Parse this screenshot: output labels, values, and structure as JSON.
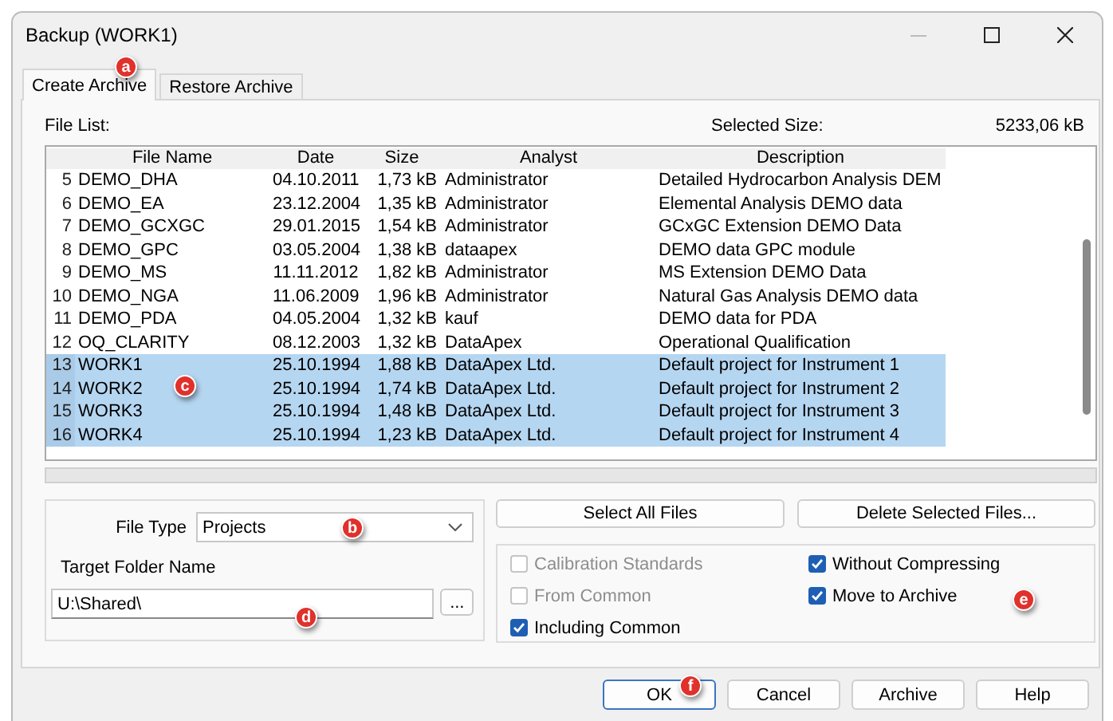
{
  "window": {
    "title": "Backup (WORK1)"
  },
  "tabs": [
    {
      "label": "Create Archive",
      "selected": true,
      "callout": "a"
    },
    {
      "label": "Restore Archive",
      "selected": false
    }
  ],
  "file_list": {
    "label": "File List:",
    "selected_size_label": "Selected Size:",
    "selected_size": "5233,06 kB"
  },
  "table": {
    "columns": [
      "File Name",
      "Date",
      "Size",
      "Analyst",
      "Description"
    ],
    "callout": "c",
    "rows": [
      {
        "number": "5",
        "cells": [
          "DEMO_DHA",
          "04.10.2011",
          "1,73 kB",
          "Administrator",
          "Detailed Hydrocarbon Analysis DEM"
        ],
        "selected": false
      },
      {
        "number": "6",
        "cells": [
          "DEMO_EA",
          "23.12.2004",
          "1,35 kB",
          "Administrator",
          "Elemental Analysis DEMO data"
        ],
        "selected": false
      },
      {
        "number": "7",
        "cells": [
          "DEMO_GCXGC",
          "29.01.2015",
          "1,54 kB",
          "Administrator",
          "GCxGC Extension DEMO Data"
        ],
        "selected": false
      },
      {
        "number": "8",
        "cells": [
          "DEMO_GPC",
          "03.05.2004",
          "1,38 kB",
          "dataapex",
          "DEMO data GPC module"
        ],
        "selected": false
      },
      {
        "number": "9",
        "cells": [
          "DEMO_MS",
          "11.11.2012",
          "1,82 kB",
          "Administrator",
          "MS Extension DEMO Data"
        ],
        "selected": false
      },
      {
        "number": "10",
        "cells": [
          "DEMO_NGA",
          "11.06.2009",
          "1,96 kB",
          "Administrator",
          "Natural Gas Analysis DEMO data"
        ],
        "selected": false
      },
      {
        "number": "11",
        "cells": [
          "DEMO_PDA",
          "04.05.2004",
          "1,32 kB",
          "kauf",
          "DEMO data for PDA"
        ],
        "selected": false
      },
      {
        "number": "12",
        "cells": [
          "OQ_CLARITY",
          "08.12.2003",
          "1,32 kB",
          "DataApex",
          "Operational Qualification"
        ],
        "selected": false
      },
      {
        "number": "13",
        "cells": [
          "WORK1",
          "25.10.1994",
          "1,88 kB",
          "DataApex Ltd.",
          "Default project for Instrument 1"
        ],
        "selected": true
      },
      {
        "number": "14",
        "cells": [
          "WORK2",
          "25.10.1994",
          "1,74 kB",
          "DataApex Ltd.",
          "Default project for Instrument 2"
        ],
        "selected": true
      },
      {
        "number": "15",
        "cells": [
          "WORK3",
          "25.10.1994",
          "1,48 kB",
          "DataApex Ltd.",
          "Default project for Instrument 3"
        ],
        "selected": true
      },
      {
        "number": "16",
        "cells": [
          "WORK4",
          "25.10.1994",
          "1,23 kB",
          "DataApex Ltd.",
          "Default project for Instrument 4"
        ],
        "selected": true
      }
    ]
  },
  "file_type": {
    "label": "File Type",
    "value": "Projects",
    "callout": "b"
  },
  "target_folder": {
    "label": "Target Folder Name",
    "value": "U:\\Shared\\",
    "browse": "...",
    "callout": "d"
  },
  "actions": [
    "Select All Files",
    "Delete Selected Files..."
  ],
  "options_left": [
    {
      "label": "Calibration Standards",
      "checked": false,
      "disabled": true
    },
    {
      "label": "From Common",
      "checked": false,
      "disabled": true
    },
    {
      "label": "Including Common",
      "checked": true,
      "disabled": false
    }
  ],
  "options_right": [
    {
      "label": "Without Compressing",
      "checked": true,
      "disabled": false
    },
    {
      "label": "Move to Archive",
      "checked": true,
      "disabled": false,
      "callout": "e"
    }
  ],
  "buttons": [
    {
      "label": "OK",
      "default": true,
      "callout": "f"
    },
    {
      "label": "Cancel",
      "default": false
    },
    {
      "label": "Archive",
      "default": false
    },
    {
      "label": "Help",
      "default": false
    }
  ]
}
